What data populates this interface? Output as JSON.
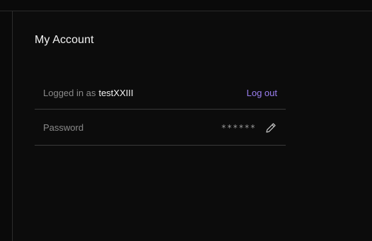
{
  "account": {
    "title": "My Account",
    "logged_in_label": "Logged in as",
    "username": "testXXIII",
    "logout_label": "Log out"
  },
  "password": {
    "label": "Password",
    "masked_value": "******",
    "edit_icon": "pencil-icon"
  },
  "colors": {
    "background": "#0c0c0c",
    "accent": "#9b7ff0",
    "muted_text": "#8a8a8a",
    "divider": "#3a3a3a"
  }
}
